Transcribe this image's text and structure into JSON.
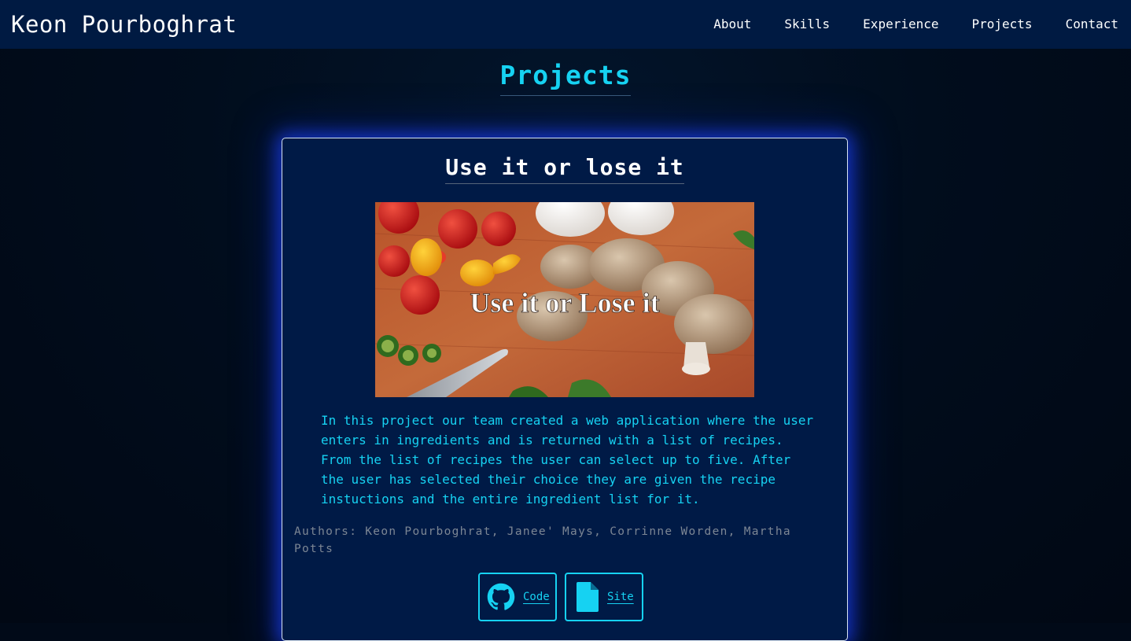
{
  "navbar": {
    "brand": "Keon Pourboghrat",
    "links": [
      "About",
      "Skills",
      "Experience",
      "Projects",
      "Contact"
    ]
  },
  "section": {
    "title": "Projects"
  },
  "project": {
    "title": "Use it or lose it",
    "image_caption": "Use it or Lose it",
    "description": "In this project our team created a web application where the user enters in ingredients and is returned with a list of recipes. From the list of recipes the user can select up to five. After the user has selected their choice they are given the recipe instuctions and the entire ingredient list for it.",
    "authors": "Authors: Keon Pourboghrat, Janee' Mays, Corrinne Worden, Martha Potts",
    "buttons": {
      "code": "Code",
      "site": "Site"
    }
  },
  "colors": {
    "accent": "#16d2f2",
    "navbar": "#001a42",
    "card": "#001a46",
    "background": "#010a18"
  },
  "icons": {
    "code_button": "github-icon",
    "site_button": "document-icon"
  }
}
